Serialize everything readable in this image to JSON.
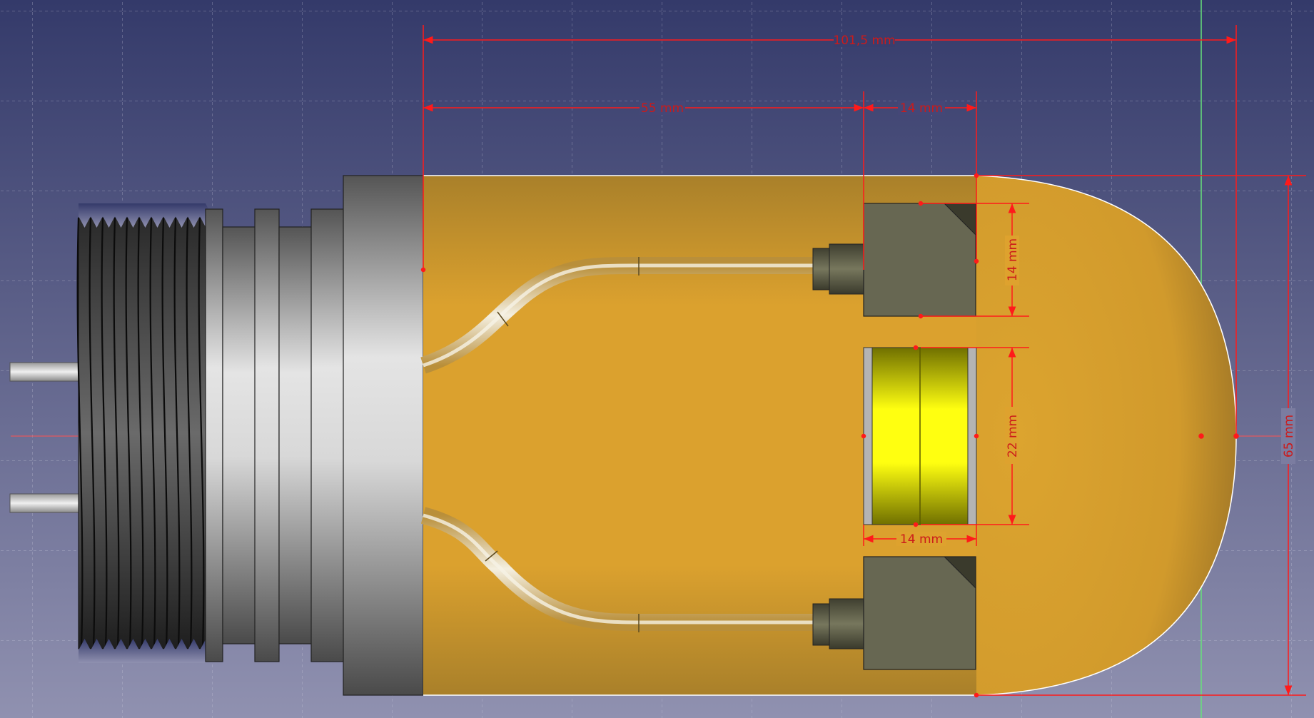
{
  "dimensions": {
    "overall_length": "101,5 mm",
    "base_to_block": "55 mm",
    "block_width_top": "14 mm",
    "block_height_top": "14 mm",
    "magnet_height": "22 mm",
    "magnet_width": "14 mm",
    "overall_height": "65 mm"
  },
  "colors": {
    "background_top": "#363b6b",
    "background_bottom": "#8e8fae",
    "dimension_line": "#ff1a1a",
    "grid": "#c8c8d8",
    "axis_green": "#66e27a",
    "bulb_fill": "#dea22e",
    "block_fill": "#676752",
    "magnet_fill": "#ffff00"
  }
}
